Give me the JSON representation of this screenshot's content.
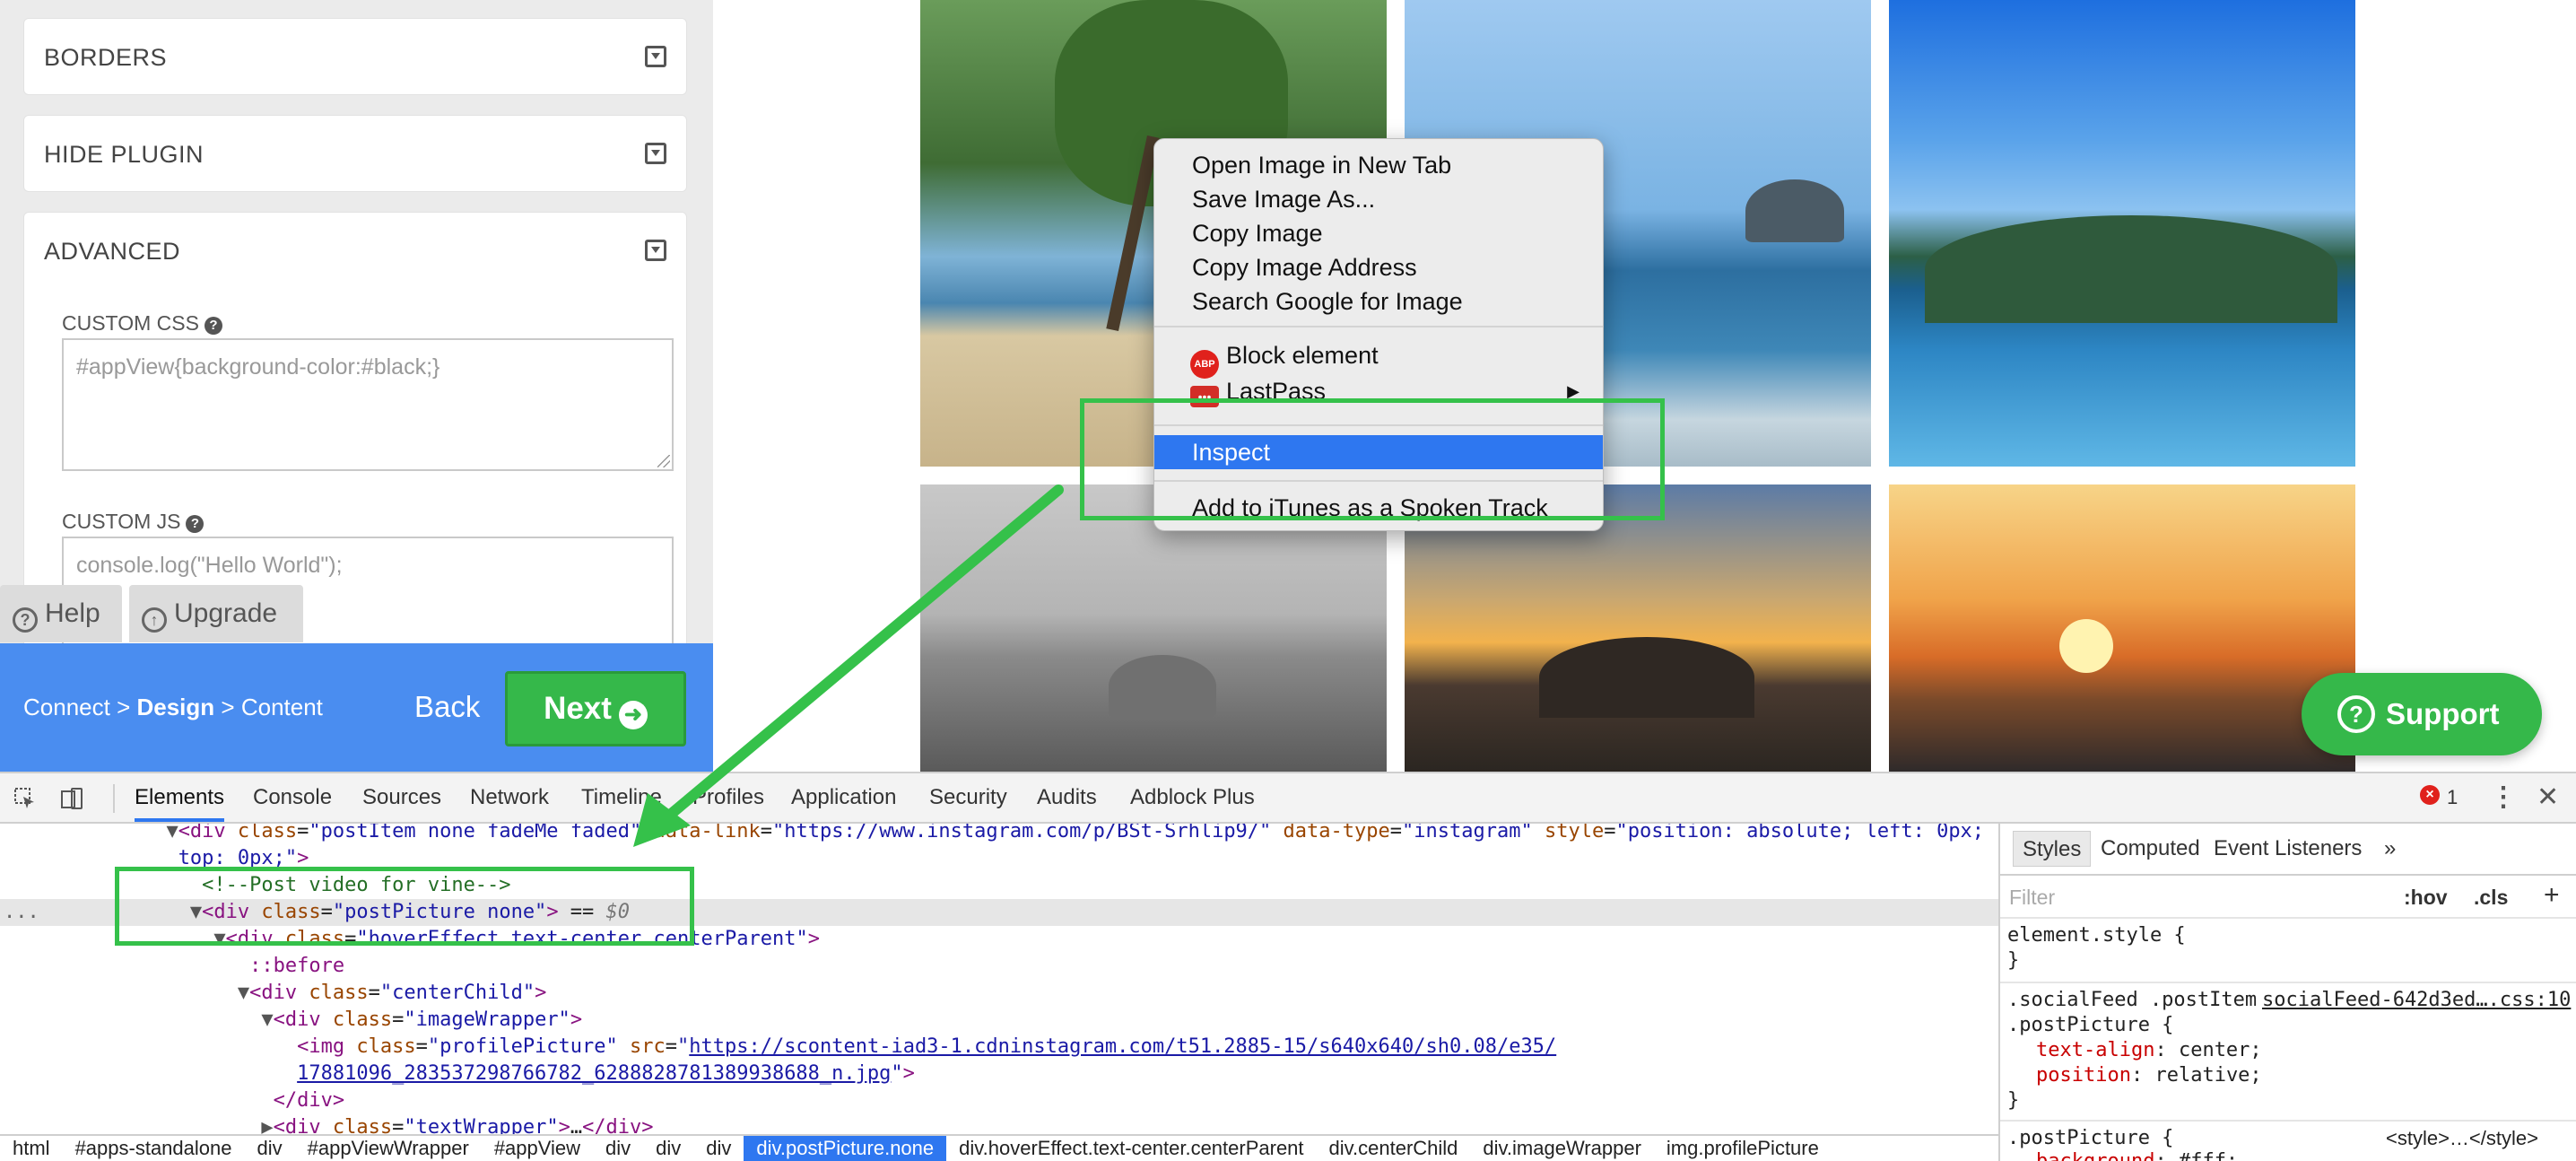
{
  "settings_panel": {
    "accordions": [
      "BORDERS",
      "HIDE PLUGIN",
      "ADVANCED"
    ],
    "custom_css_label": "CUSTOM CSS",
    "custom_css_value": "#appView{background-color:#black;}",
    "custom_js_label": "CUSTOM JS",
    "custom_js_value": "console.log(\"Hello World\");",
    "help_label": "Help",
    "upgrade_label": "Upgrade"
  },
  "wizard": {
    "step1": "Connect >",
    "step2": "Design",
    "step2_sep": ">",
    "step3": "Content",
    "back_label": "Back",
    "next_label": "Next"
  },
  "context_menu": {
    "items": [
      "Open Image in New Tab",
      "Save Image As...",
      "Copy Image",
      "Copy Image Address",
      "Search Google for Image"
    ],
    "extensions": [
      "Block element",
      "LastPass"
    ],
    "abp_badge": "ABP",
    "lastpass_badge": "•••",
    "inspect": "Inspect",
    "itunes": "Add to iTunes as a Spoken Track"
  },
  "support_label": "Support",
  "devtools": {
    "tabs": [
      "Elements",
      "Console",
      "Sources",
      "Network",
      "Timeline",
      "Profiles",
      "Application",
      "Security",
      "Audits",
      "Adblock Plus"
    ],
    "error_count": "1",
    "dom_lines": [
      {
        "indent": 4,
        "tri": "▼",
        "html": "<span class=\"tag\">&lt;div</span> <span class=\"attr\">class</span>=<span class=\"val\">\"postItem none fadeMe faded\"</span> <span class=\"attr\">data-link</span>=<span class=\"val\">\"https://www.instagram.com/p/BSt-Srhlip9/\"</span> <span class=\"attr\">data-type</span>=<span class=\"val\">\"instagram\"</span> <span class=\"attr\">style</span>=<span class=\"val\">\"position: absolute; left: 0px;</span>"
      },
      {
        "indent": 4,
        "tri": "",
        "html": "<span class=\"val\">top: 0px;\"</span><span class=\"tag\">&gt;</span>"
      },
      {
        "indent": 5,
        "tri": "",
        "html": "<span class=\"comment\">&lt;!--Post video for vine--&gt;</span>"
      },
      {
        "indent": 5,
        "tri": "▼",
        "html": "<span class=\"tag\">&lt;div</span> <span class=\"attr\">class</span>=<span class=\"val\">\"postPicture none\"</span><span class=\"tag\">&gt;</span> == <span class=\"dollar\">$0</span>"
      },
      {
        "indent": 6,
        "tri": "▼",
        "html": "<span class=\"tag\">&lt;div</span> <span class=\"attr\">class</span>=<span class=\"val\">\"hoverEffect text-center centerParent\"</span><span class=\"tag\">&gt;</span>"
      },
      {
        "indent": 7,
        "tri": "",
        "html": "<span class=\"pseudo\">::before</span>"
      },
      {
        "indent": 7,
        "tri": "▼",
        "html": "<span class=\"tag\">&lt;div</span> <span class=\"attr\">class</span>=<span class=\"val\">\"centerChild\"</span><span class=\"tag\">&gt;</span>"
      },
      {
        "indent": 8,
        "tri": "▼",
        "html": "<span class=\"tag\">&lt;div</span> <span class=\"attr\">class</span>=<span class=\"val\">\"imageWrapper\"</span><span class=\"tag\">&gt;</span>"
      },
      {
        "indent": 9,
        "tri": "",
        "html": "<span class=\"tag\">&lt;img</span> <span class=\"attr\">class</span>=<span class=\"val\">\"profilePicture\"</span> <span class=\"attr\">src</span>=<span class=\"val\">\"</span><span class=\"link\">https://scontent-iad3-1.cdninstagram.com/t51.2885-15/s640x640/sh0.08/e35/</span>"
      },
      {
        "indent": 9,
        "tri": "",
        "html": "<span class=\"link\">17881096_283537298766782_6288828781389938688_n.jpg</span><span class=\"val\">\"</span><span class=\"tag\">&gt;</span>"
      },
      {
        "indent": 8,
        "tri": "",
        "html": "<span class=\"tag\">&lt;/div&gt;</span>"
      },
      {
        "indent": 8,
        "tri": "▶",
        "html": "<span class=\"tag\">&lt;div</span> <span class=\"attr\">class</span>=<span class=\"val\">\"textWrapper\"</span><span class=\"tag\">&gt;</span>…<span class=\"tag\">&lt;/div&gt;</span>"
      }
    ],
    "breadcrumbs": [
      "html",
      "#apps-standalone",
      "div",
      "#appViewWrapper",
      "#appView",
      "div",
      "div",
      "div",
      "div.postPicture.none",
      "div.hoverEffect.text-center.centerParent",
      "div.centerChild",
      "div.imageWrapper",
      "img.profilePicture"
    ],
    "styles_tabs": [
      "Styles",
      "Computed",
      "Event Listeners"
    ],
    "filter_placeholder": "Filter",
    "hov": ":hov",
    "cls": ".cls",
    "element_style": "element.style {",
    "rule1_selector_a": ".socialFeed .postItem",
    "rule1_source": "socialFeed-642d3ed….css:10",
    "rule1_selector_b": ".postPicture {",
    "rule1_prop1": "text-align",
    "rule1_val1": "center;",
    "rule1_prop2": "position",
    "rule1_val2": "relative;",
    "rule2_selector": ".postPicture {",
    "rule2_source": "<style>…</style>",
    "rule2_prop1": "background",
    "rule2_val1": "#fff;"
  },
  "colors": {
    "wizard_blue": "#4a8df0",
    "green_accent": "#35b84a",
    "annotation_green": "#35c14a",
    "menu_highlight": "#2e77f0"
  }
}
